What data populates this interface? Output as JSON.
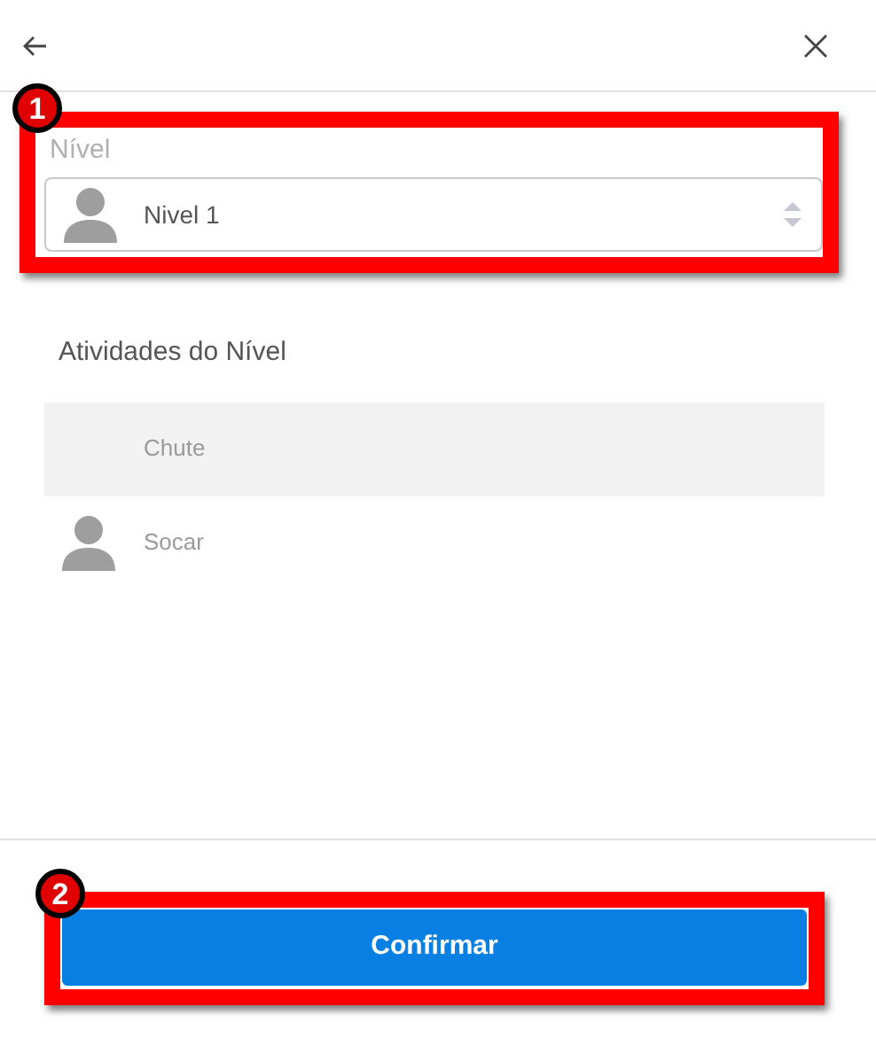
{
  "level_field": {
    "label": "Nível",
    "value": "Nivel 1"
  },
  "activities": {
    "title": "Atividades do Nível",
    "items": [
      {
        "label": "Chute",
        "selected": true,
        "avatar": false
      },
      {
        "label": "Socar",
        "selected": false,
        "avatar": true
      }
    ]
  },
  "confirm_button": "Confirmar",
  "callouts": [
    {
      "number": "1"
    },
    {
      "number": "2"
    }
  ]
}
